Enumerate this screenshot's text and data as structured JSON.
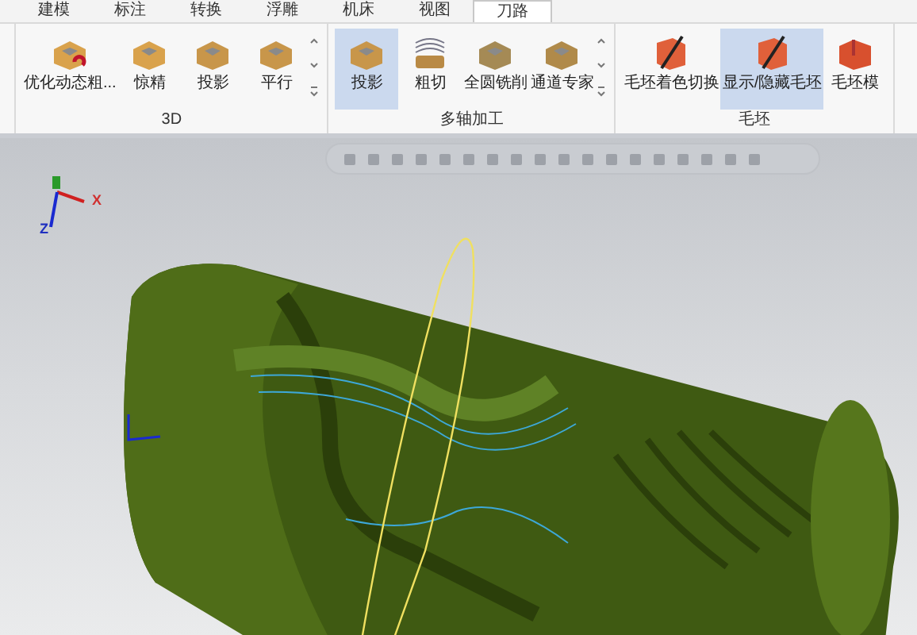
{
  "tabs": [
    {
      "label": "建模",
      "selected": false
    },
    {
      "label": "标注",
      "selected": false
    },
    {
      "label": "转换",
      "selected": false
    },
    {
      "label": "浮雕",
      "selected": false
    },
    {
      "label": "机床",
      "selected": false
    },
    {
      "label": "视图",
      "selected": false
    },
    {
      "label": "刀路",
      "selected": true
    }
  ],
  "groups": [
    {
      "label": "3D",
      "items": [
        {
          "label": "优化动态粗...",
          "selected": false,
          "kind": "rough"
        },
        {
          "label": "惊精",
          "selected": false,
          "kind": "block"
        },
        {
          "label": "投影",
          "selected": false,
          "kind": "project"
        },
        {
          "label": "平行",
          "selected": false,
          "kind": "parallel"
        }
      ],
      "scroller": true
    },
    {
      "label": "多轴加工",
      "items": [
        {
          "label": "投影",
          "selected": true,
          "kind": "project"
        },
        {
          "label": "粗切",
          "selected": false,
          "kind": "layers"
        },
        {
          "label": "全圆铣削",
          "selected": false,
          "kind": "round"
        },
        {
          "label": "通道专家",
          "selected": false,
          "kind": "channel"
        }
      ],
      "scroller": true
    },
    {
      "label": "毛坯",
      "items": [
        {
          "label": "毛坯着色切换",
          "selected": false,
          "kind": "stock"
        },
        {
          "label": "显示/隐藏毛坯",
          "selected": true,
          "kind": "stock"
        },
        {
          "label": "毛坯模",
          "selected": false,
          "kind": "stockmodel"
        }
      ],
      "scroller": false
    }
  ],
  "viewport": {
    "axes": [
      {
        "label": "X"
      },
      {
        "label": "Z"
      }
    ]
  }
}
